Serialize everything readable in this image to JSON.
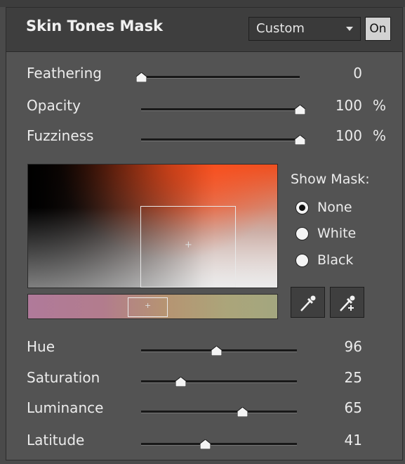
{
  "panel": {
    "title": "Skin Tones Mask",
    "preset": "Custom",
    "on_label": "On"
  },
  "top_sliders": [
    {
      "label": "Feathering",
      "value": "0",
      "unit": "",
      "level": 0.0
    },
    {
      "label": "Opacity",
      "value": "100",
      "unit": "%",
      "level": 1.0
    },
    {
      "label": "Fuzziness",
      "value": "100",
      "unit": "%",
      "level": 1.0
    }
  ],
  "show_mask": {
    "title": "Show Mask:",
    "options": [
      {
        "label": "None",
        "checked": true
      },
      {
        "label": "White",
        "checked": false
      },
      {
        "label": "Black",
        "checked": false
      }
    ]
  },
  "tools": {
    "eyedropper_icon": "eyedropper-icon",
    "eyedropper_add_icon": "eyedropper-plus-icon"
  },
  "bottom_sliders": [
    {
      "label": "Hue",
      "value": "96",
      "level": 0.48
    },
    {
      "label": "Saturation",
      "value": "25",
      "level": 0.25
    },
    {
      "label": "Luminance",
      "value": "65",
      "level": 0.65
    },
    {
      "label": "Latitude",
      "value": "41",
      "level": 0.41
    }
  ],
  "colors": {
    "panel_bg": "#535353",
    "header_bg": "#3e3e3e",
    "accent_orange": "#ee4f1f",
    "on_button": "#d2d2d2"
  }
}
